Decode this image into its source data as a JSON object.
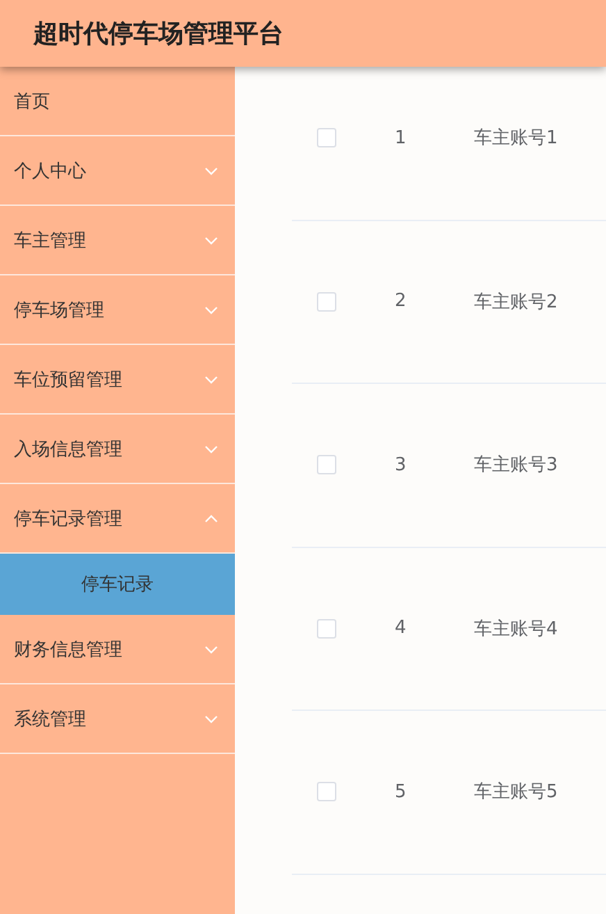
{
  "header": {
    "title": "超时代停车场管理平台"
  },
  "sidebar": {
    "items": [
      {
        "label": "首页",
        "expandable": false,
        "selected": false
      },
      {
        "label": "个人中心",
        "expandable": true,
        "expanded": false,
        "selected": false
      },
      {
        "label": "车主管理",
        "expandable": true,
        "expanded": false,
        "selected": false
      },
      {
        "label": "停车场管理",
        "expandable": true,
        "expanded": false,
        "selected": false
      },
      {
        "label": "车位预留管理",
        "expandable": true,
        "expanded": false,
        "selected": false
      },
      {
        "label": "入场信息管理",
        "expandable": true,
        "expanded": false,
        "selected": false
      },
      {
        "label": "停车记录管理",
        "expandable": true,
        "expanded": true,
        "selected": false,
        "children": [
          {
            "label": "停车记录",
            "selected": true
          }
        ]
      },
      {
        "label": "财务信息管理",
        "expandable": true,
        "expanded": false,
        "selected": false
      },
      {
        "label": "系统管理",
        "expandable": true,
        "expanded": false,
        "selected": false
      }
    ]
  },
  "table": {
    "rows": [
      {
        "checked": false,
        "index": "1",
        "account": "车主账号1"
      },
      {
        "checked": false,
        "index": "2",
        "account": "车主账号2"
      },
      {
        "checked": false,
        "index": "3",
        "account": "车主账号3"
      },
      {
        "checked": false,
        "index": "4",
        "account": "车主账号4"
      },
      {
        "checked": false,
        "index": "5",
        "account": "车主账号5"
      }
    ]
  }
}
